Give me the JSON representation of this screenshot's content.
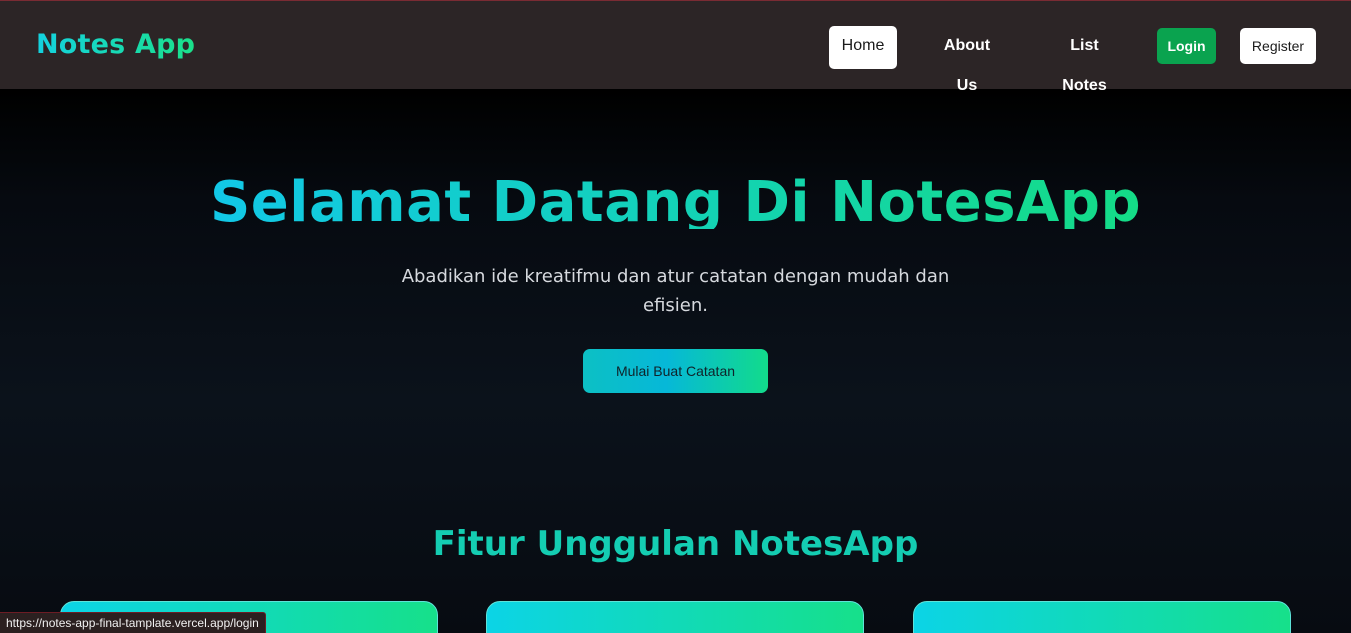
{
  "navbar": {
    "brand": "Notes App",
    "links": {
      "home": "Home",
      "about": "About Us",
      "list_notes": "List Notes"
    },
    "login_label": "Login",
    "register_label": "Register"
  },
  "hero": {
    "title": "Selamat Datang Di NotesApp",
    "subtitle": "Abadikan ide kreatifmu dan atur catatan dengan mudah dan efisien.",
    "cta_label": "Mulai Buat Catatan"
  },
  "features": {
    "title": "Fitur Unggulan NotesApp"
  },
  "status_bar": {
    "url": "https://notes-app-final-tamplate.vercel.app/login"
  },
  "colors": {
    "navbar_bg": "#2c2526",
    "accent_cyan": "#14d2e0",
    "accent_green": "#1be08a",
    "login_green": "#0aa34f",
    "features_title": "#14cdb2"
  }
}
